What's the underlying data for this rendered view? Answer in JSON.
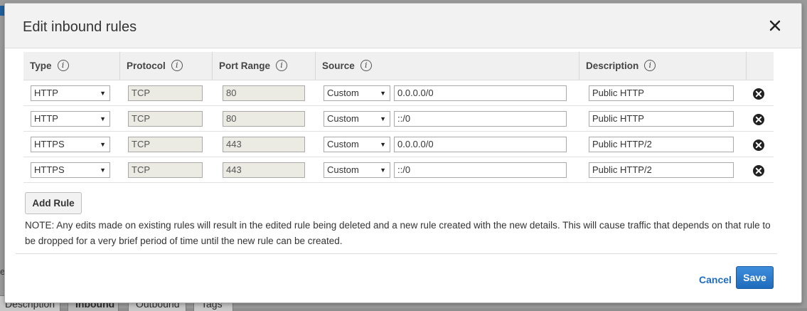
{
  "dialog": {
    "title": "Edit inbound rules",
    "close_symbol": "×"
  },
  "table": {
    "headers": {
      "type": "Type",
      "protocol": "Protocol",
      "port_range": "Port Range",
      "source": "Source",
      "description": "Description"
    },
    "info_symbol": "i",
    "rows": [
      {
        "type": "HTTP",
        "protocol": "TCP",
        "port": "80",
        "source_type": "Custom",
        "source": "0.0.0.0/0",
        "description": "Public HTTP"
      },
      {
        "type": "HTTP",
        "protocol": "TCP",
        "port": "80",
        "source_type": "Custom",
        "source": "::/0",
        "description": "Public HTTP"
      },
      {
        "type": "HTTPS",
        "protocol": "TCP",
        "port": "443",
        "source_type": "Custom",
        "source": "0.0.0.0/0",
        "description": "Public HTTP/2"
      },
      {
        "type": "HTTPS",
        "protocol": "TCP",
        "port": "443",
        "source_type": "Custom",
        "source": "::/0",
        "description": "Public HTTP/2"
      }
    ]
  },
  "add_rule_label": "Add Rule",
  "note": "NOTE: Any edits made on existing rules will result in the edited rule being deleted and a new rule created with the new details. This will cause traffic that depends on that rule to be dropped for a very brief period of time until the new rule can be created.",
  "footer": {
    "cancel_label": "Cancel",
    "save_label": "Save"
  },
  "background": {
    "left_char": "e",
    "tabs": [
      "Description",
      "Inbound",
      "Outbound",
      "Tags"
    ],
    "active_tab": "Inbound"
  },
  "colors": {
    "primary_button": "#1f6bbd",
    "link": "#1f6dbb",
    "header_bg": "#f2f2f2",
    "readonly_bg": "#ebebe4"
  },
  "icons": {
    "close": "close-icon",
    "info": "info-icon",
    "remove": "remove-circle-icon",
    "dropdown": "chevron-down-icon"
  }
}
